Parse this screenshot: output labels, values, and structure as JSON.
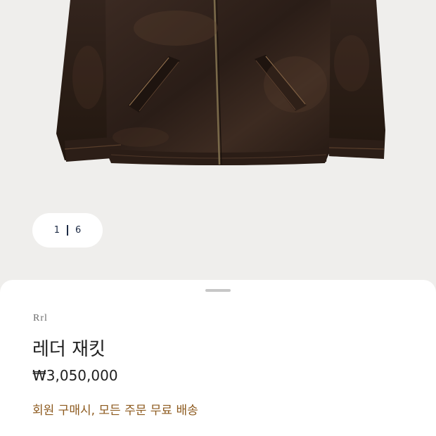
{
  "gallery": {
    "image_alt": "leather-jacket-photo",
    "current_index": "1",
    "total": "6"
  },
  "product": {
    "brand": "Rrl",
    "title": "레더 재킷",
    "price": "₩3,050,000",
    "promo": "회원 구매시, 모든 주문 무료 배송"
  },
  "colors": {
    "background": "#efeeec",
    "sheet": "#ffffff",
    "text": "#1f1f1f",
    "pager_text": "#1c2a44",
    "promo": "#8d5a1e"
  }
}
